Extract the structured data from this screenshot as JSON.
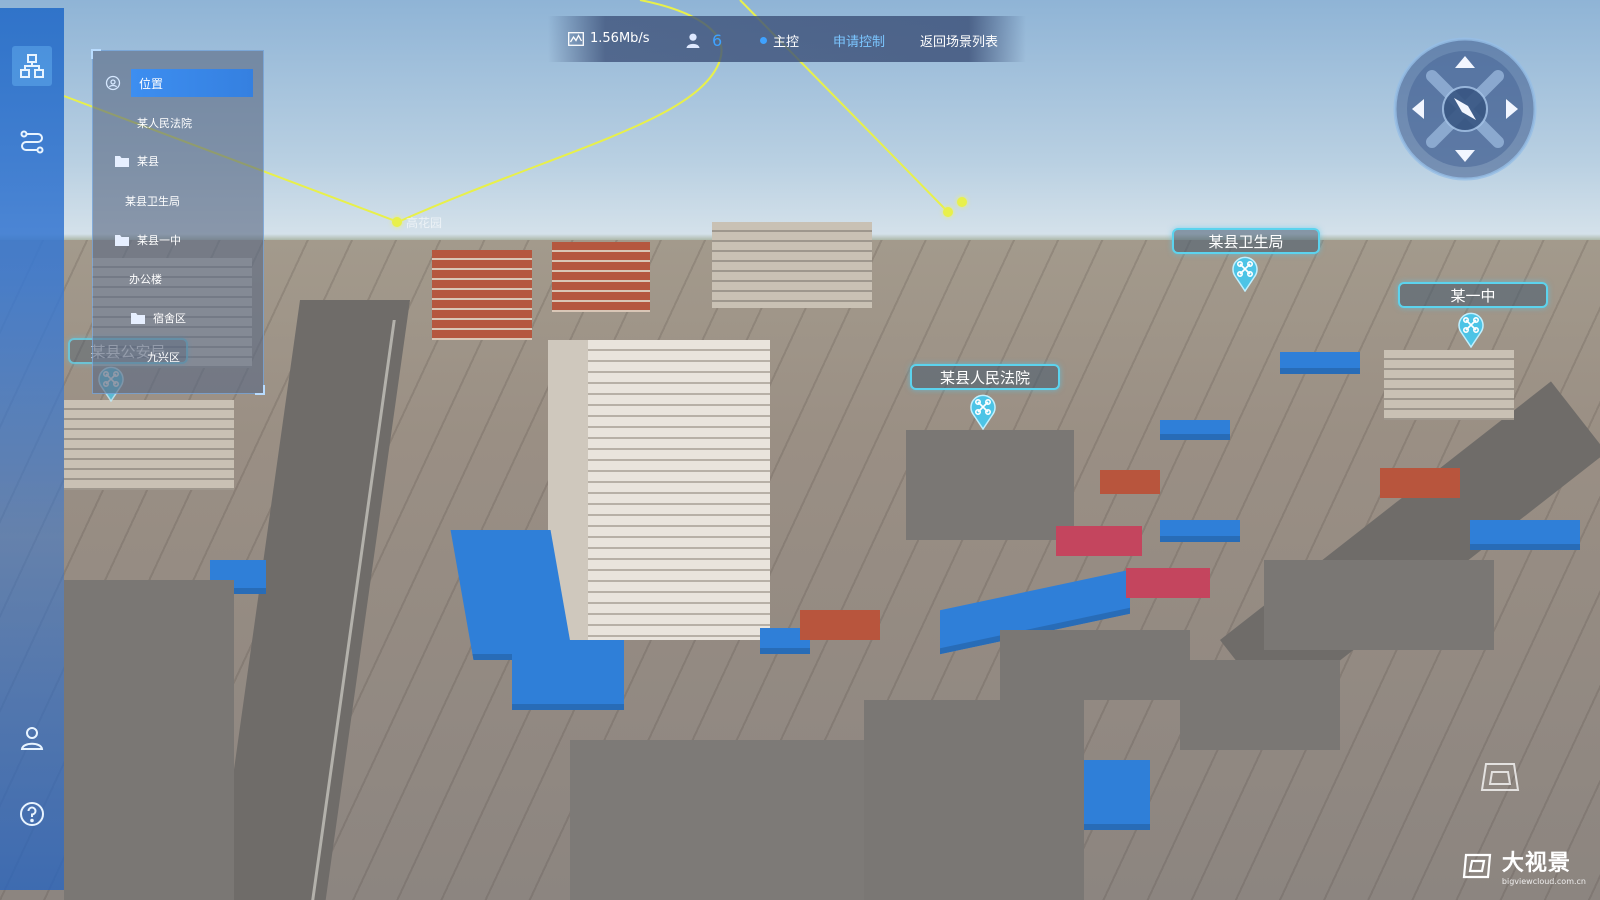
{
  "topbar": {
    "bandwidth": "1.56Mb/s",
    "user_count": "6",
    "master_label": "主控",
    "request_control": "申请控制",
    "return_scene_list": "返回场景列表"
  },
  "leftnav": {
    "items": [
      {
        "icon": "network-hierarchy-icon",
        "active": true
      },
      {
        "icon": "route-path-icon",
        "active": false
      },
      {
        "icon": "user-icon",
        "active": false
      },
      {
        "icon": "help-icon",
        "active": false
      }
    ]
  },
  "tree": {
    "header": "位置",
    "items": [
      {
        "label": "某人民法院",
        "folder": false
      },
      {
        "label": "某县",
        "folder": true
      },
      {
        "label": "某县卫生局",
        "folder": false
      },
      {
        "label": "某县一中",
        "folder": true
      },
      {
        "label": "办公楼",
        "folder": false
      },
      {
        "label": "宿舍区",
        "folder": true
      },
      {
        "label": "九兴区",
        "folder": false
      }
    ]
  },
  "markers": [
    {
      "label": "某县卫生局"
    },
    {
      "label": "某一中"
    },
    {
      "label": "某县人民法院"
    },
    {
      "label": "某县公安局"
    }
  ],
  "path_label": "高花园",
  "brand": {
    "name": "大视景",
    "url": "bigviewcloud.com.cn"
  },
  "colors": {
    "accent": "#3d8ef0",
    "marker_border": "#5cd3ee",
    "path_line": "#e8f04a",
    "nav_bg": "#2e6ec8"
  }
}
